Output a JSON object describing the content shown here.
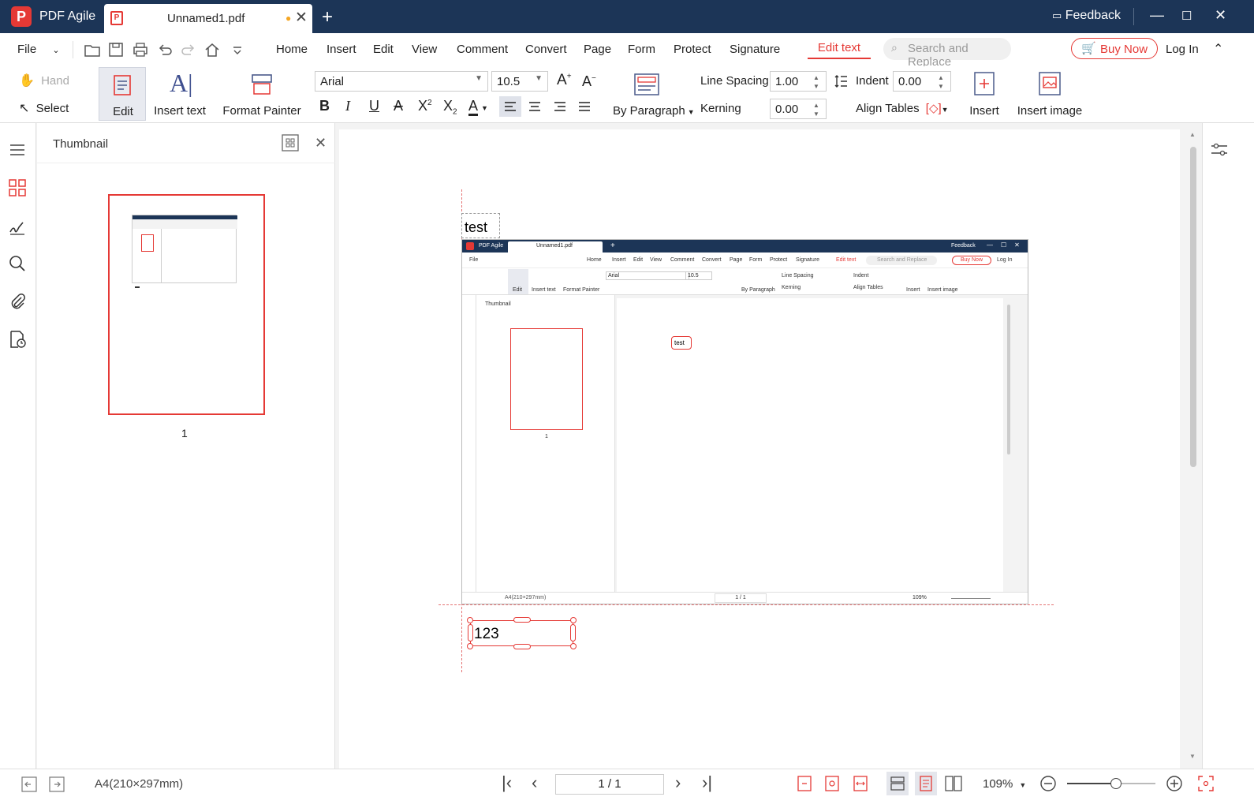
{
  "titlebar": {
    "app_name": "PDF Agile",
    "tab_title": "Unnamed1.pdf",
    "feedback": "Feedback"
  },
  "menubar": {
    "file": "File",
    "items": [
      "Home",
      "Insert",
      "Edit",
      "View",
      "Comment",
      "Convert",
      "Page",
      "Form",
      "Protect",
      "Signature"
    ],
    "active_tab": "Edit text",
    "search_placeholder": "Search and Replace",
    "buy_now": "Buy Now",
    "login": "Log In"
  },
  "ribbon": {
    "hand": "Hand",
    "select": "Select",
    "edit": "Edit",
    "insert_text": "Insert text",
    "format_painter": "Format Painter",
    "font": "Arial",
    "font_size": "10.5",
    "by_paragraph": "By Paragraph",
    "line_spacing_label": "Line Spacing",
    "line_spacing": "1.00",
    "indent_label": "Indent",
    "indent": "0.00",
    "kerning_label": "Kerning",
    "kerning": "0.00",
    "align_tables": "Align Tables",
    "insert": "Insert",
    "insert_image": "Insert image"
  },
  "thumbnail": {
    "title": "Thumbnail",
    "page_number": "1"
  },
  "document": {
    "text_box_1": "test",
    "text_box_2": "123"
  },
  "embedded": {
    "app_name": "PDF Agile",
    "tab_title": "Unnamed1.pdf",
    "feedback": "Feedback",
    "text": "test",
    "page_size": "A4(210×297mm)",
    "page": "1 / 1",
    "zoom": "109%",
    "thumb_num": "1",
    "thumbnail": "Thumbnail"
  },
  "statusbar": {
    "page_size": "A4(210×297mm)",
    "page": "1 / 1",
    "zoom": "109%",
    "zoom_level": 0.55
  },
  "colors": {
    "titlebar": "#1c3557",
    "accent": "#e53935"
  }
}
